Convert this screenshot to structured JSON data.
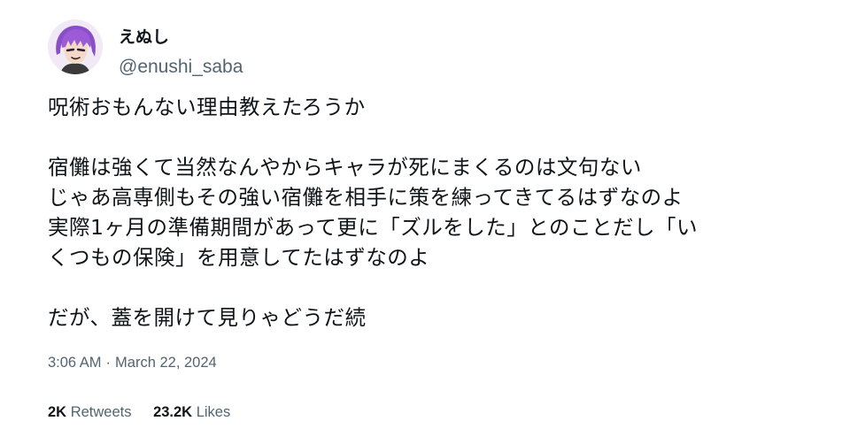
{
  "author": {
    "display_name": "えぬし",
    "handle": "@enushi_saba",
    "avatar_icon": "anime-avatar-icon",
    "avatar_hair_color": "#8a4fc6"
  },
  "tweet": {
    "lines": [
      "呪術おもんない理由教えたろうか",
      "",
      "宿儺は強くて当然なんやからキャラが死にまくるのは文句ない",
      "じゃあ高専側もその強い宿儺を相手に策を練ってきてるはずなのよ",
      "実際1ヶ月の準備期間があって更に「ズルをした」とのことだし「い",
      "くつもの保険」を用意してたはずなのよ",
      "",
      "だが、蓋を開けて見りゃどうだ続"
    ]
  },
  "meta": {
    "time": "3:06 AM",
    "separator": "·",
    "date": "March 22, 2024"
  },
  "stats": {
    "retweets_count": "2K",
    "retweets_label": "Retweets",
    "likes_count": "23.2K",
    "likes_label": "Likes"
  }
}
